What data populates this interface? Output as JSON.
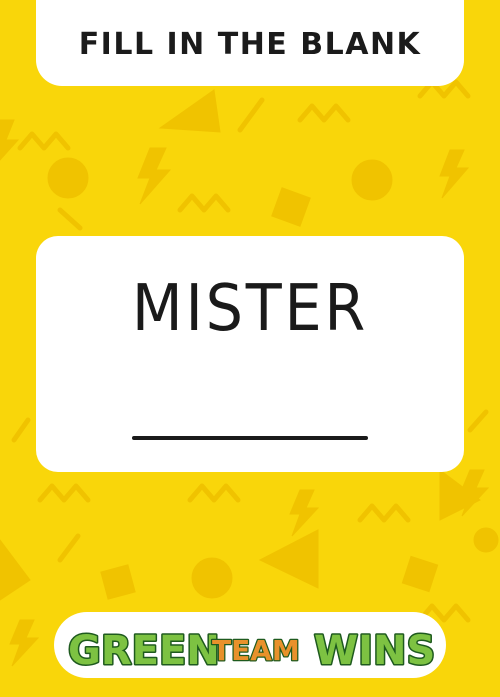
{
  "header": {
    "title": "FILL IN THE BLANK"
  },
  "card": {
    "word": "MISTER"
  },
  "logo": {
    "word1": "GREEN",
    "word2": "TEAM",
    "word3": "WINS"
  },
  "colors": {
    "background": "#F9D60A",
    "pattern_shape": "#F0C300",
    "card": "#FFFFFF",
    "text": "#1B1B1B",
    "logo_green": "#7DC242",
    "logo_orange": "#E8912B",
    "logo_outline": "#1E5A1E"
  },
  "icons": [
    "lightning-icon",
    "triangle-shape",
    "circle-shape",
    "square-shape",
    "zigzag-shape"
  ]
}
